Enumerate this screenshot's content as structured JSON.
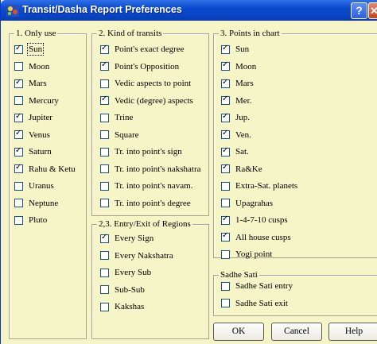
{
  "window": {
    "title": "Transit/Dasha Report Preferences",
    "help_glyph": "?",
    "close_glyph": "✕"
  },
  "groups": {
    "only_use": {
      "title": "1. Only use",
      "items": [
        {
          "label": "Sun",
          "checked": true
        },
        {
          "label": "Moon",
          "checked": false
        },
        {
          "label": "Mars",
          "checked": true
        },
        {
          "label": "Mercury",
          "checked": false
        },
        {
          "label": "Jupiter",
          "checked": true
        },
        {
          "label": "Venus",
          "checked": true
        },
        {
          "label": "Saturn",
          "checked": true
        },
        {
          "label": "Rahu & Ketu",
          "checked": true
        },
        {
          "label": "Uranus",
          "checked": false
        },
        {
          "label": "Neptune",
          "checked": false
        },
        {
          "label": "Pluto",
          "checked": false
        }
      ]
    },
    "kind_of_transits": {
      "title": "2. Kind of transits",
      "items": [
        {
          "label": "Point's exact degree",
          "checked": true
        },
        {
          "label": "Point's Opposition",
          "checked": true
        },
        {
          "label": "Vedic aspects to point",
          "checked": false
        },
        {
          "label": "Vedic (degree) aspects",
          "checked": true
        },
        {
          "label": "Trine",
          "checked": false
        },
        {
          "label": "Square",
          "checked": false
        },
        {
          "label": "Tr. into point's sign",
          "checked": false
        },
        {
          "label": "Tr. into point's nakshatra",
          "checked": false
        },
        {
          "label": "Tr. into point's navam.",
          "checked": false
        },
        {
          "label": "Tr. into point's degree",
          "checked": false
        }
      ]
    },
    "entry_exit": {
      "title": "2,3. Entry/Exit of Regions",
      "items": [
        {
          "label": "Every Sign",
          "checked": true
        },
        {
          "label": "Every Nakshatra",
          "checked": false
        },
        {
          "label": "Every Sub",
          "checked": false
        },
        {
          "label": "Sub-Sub",
          "checked": false
        },
        {
          "label": "Kakshas",
          "checked": false
        }
      ]
    },
    "points_in_chart": {
      "title": "3. Points in chart",
      "items": [
        {
          "label": "Sun",
          "checked": true
        },
        {
          "label": "Moon",
          "checked": true
        },
        {
          "label": "Mars",
          "checked": true
        },
        {
          "label": "Mer.",
          "checked": true
        },
        {
          "label": "Jup.",
          "checked": true
        },
        {
          "label": "Ven.",
          "checked": true
        },
        {
          "label": "Sat.",
          "checked": true
        },
        {
          "label": "Ra&Ke",
          "checked": true
        },
        {
          "label": "Extra-Sat. planets",
          "checked": false
        },
        {
          "label": "Upagrahas",
          "checked": false
        },
        {
          "label": "1-4-7-10 cusps",
          "checked": true
        },
        {
          "label": "All house cusps",
          "checked": true
        },
        {
          "label": "Yogi point",
          "checked": false
        }
      ]
    },
    "sadhe_sati": {
      "title": "Sadhe Sati",
      "items": [
        {
          "label": "Sadhe Sati entry",
          "checked": false
        },
        {
          "label": "Sadhe Sati exit",
          "checked": false
        }
      ]
    }
  },
  "buttons": {
    "ok": "OK",
    "cancel": "Cancel",
    "help": "Help"
  }
}
